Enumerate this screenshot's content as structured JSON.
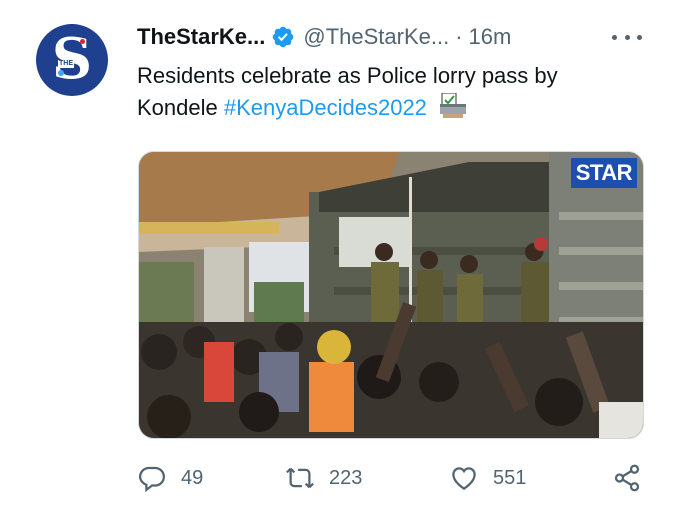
{
  "account": {
    "name": "TheStarKe...",
    "handle": "@TheStarKe...",
    "separator": "·",
    "time": "16m",
    "avatar_letter": "S",
    "avatar_small_text": "THE",
    "brand_color": "#1f3f8f",
    "verified_icon": "verified-badge-icon"
  },
  "tweet": {
    "text_line1": "Residents celebrate as Police lorry pass by",
    "text_line2": "Kondele",
    "hashtag": "#KenyaDecides2022",
    "emoji_icon": "ballot-box-icon",
    "link_color": "#1d9bf0"
  },
  "media": {
    "badge": "STAR",
    "badge_color": "#1c4fae"
  },
  "actions": {
    "replies": "49",
    "retweets": "223",
    "likes": "551",
    "reply_icon": "reply-icon",
    "retweet_icon": "retweet-icon",
    "like_icon": "heart-icon",
    "share_icon": "share-icon"
  }
}
